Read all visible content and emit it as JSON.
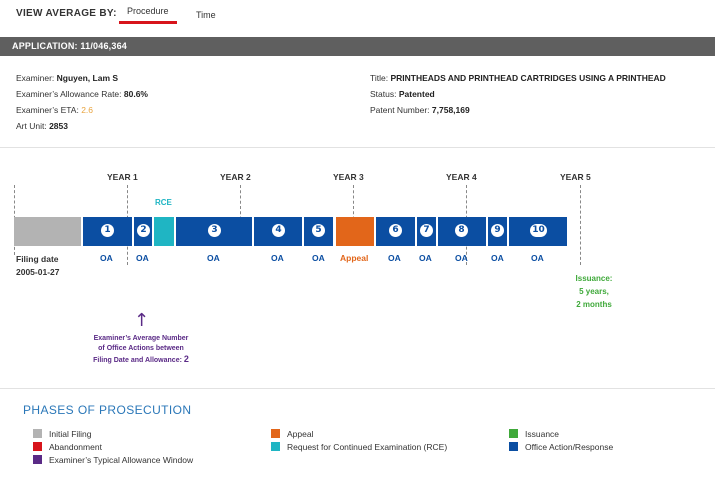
{
  "view_by": {
    "label": "VIEW AVERAGE BY:",
    "tabs": [
      "Procedure",
      "Time"
    ],
    "selected": "Procedure"
  },
  "application": {
    "title": "APPLICATION: 11/046,364",
    "examiner_label": "Examiner:",
    "examiner": "Nguyen, Lam S",
    "allowance_label": "Examiner’s Allowance Rate:",
    "allowance_rate": "80.6%",
    "eta_label": "Examiner’s ETA:",
    "eta": "2.6",
    "art_unit_label": "Art Unit:",
    "art_unit": "2853",
    "title_label": "Title:",
    "patent_title": "PRINTHEADS AND PRINTHEAD CARTRIDGES USING A PRINTHEAD",
    "status_label": "Status:",
    "status": "Patented",
    "patent_number_label": "Patent Number:",
    "patent_number": "7,758,169"
  },
  "timeline": {
    "years": [
      "YEAR 1",
      "YEAR 2",
      "YEAR 3",
      "YEAR 4",
      "YEAR 5"
    ],
    "rce_label": "RCE",
    "segments": [
      {
        "num": "1",
        "label": "OA"
      },
      {
        "num": "2",
        "label": "OA"
      },
      {
        "num": "3",
        "label": "OA"
      },
      {
        "num": "4",
        "label": "OA"
      },
      {
        "num": "5",
        "label": "OA"
      },
      {
        "num": "",
        "label": "Appeal"
      },
      {
        "num": "6",
        "label": "OA"
      },
      {
        "num": "7",
        "label": "OA"
      },
      {
        "num": "8",
        "label": "OA"
      },
      {
        "num": "9",
        "label": "OA"
      },
      {
        "num": "10",
        "label": "OA"
      }
    ],
    "filing_label": "Filing date",
    "filing_date": "2005-01-27",
    "issuance_title": "Issuance:",
    "issuance_years": "5 years,",
    "issuance_months": "2 months",
    "avg_text_1": "Examiner’s Average Number",
    "avg_text_2": "of Office Actions between",
    "avg_text_3": "Filing Date and Allowance:",
    "avg_value": "2"
  },
  "legend": {
    "title": "PHASES OF PROSECUTION",
    "items": [
      {
        "label": "Initial Filing",
        "color": "#b3b3b3"
      },
      {
        "label": "Abandonment",
        "color": "#d7141b"
      },
      {
        "label": "Examiner’s Typical Allowance Window",
        "color": "#5a2a86"
      },
      {
        "label": "Appeal",
        "color": "#e2661a"
      },
      {
        "label": "Request for Continued Examination (RCE)",
        "color": "#1fb5c3"
      },
      {
        "label": "Issuance",
        "color": "#3fa93a"
      },
      {
        "label": "Office Action/Response",
        "color": "#0b4ea2"
      }
    ]
  }
}
